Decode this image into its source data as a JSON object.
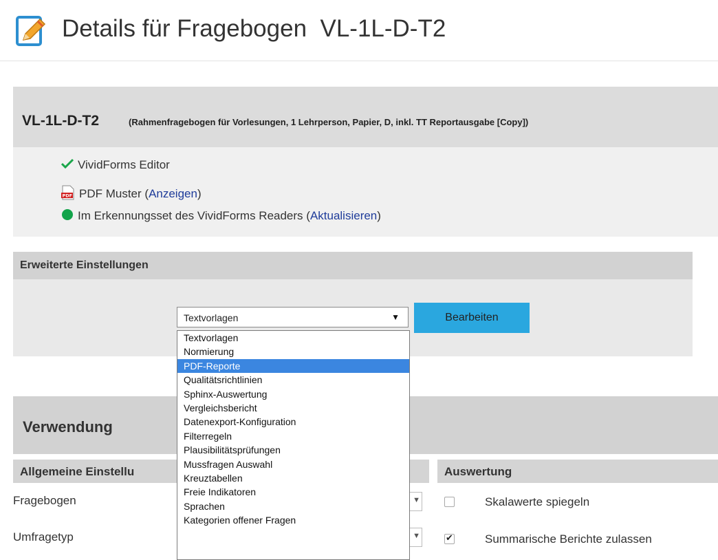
{
  "page": {
    "title": "Details für Fragebogen  VL-1L-D-T2"
  },
  "questionnaire": {
    "code": "VL-1L-D-T2",
    "description": "(Rahmenfragebogen für Vorlesungen, 1 Lehrperson, Papier, D, inkl. TT Reportausgabe [Copy])"
  },
  "status": {
    "editor": "VividForms Editor",
    "pdf_label": "PDF Muster (",
    "pdf_link": "Anzeigen",
    "pdf_close": ")",
    "reader_label": "Im Erkennungsset des VividForms Readers (",
    "reader_link": "Aktualisieren",
    "reader_close": ")"
  },
  "advanced": {
    "heading": "Erweiterte Einstellungen",
    "selected": "Textvorlagen",
    "edit_button": "Bearbeiten",
    "options": [
      "Textvorlagen",
      "Normierung",
      "PDF-Reporte",
      "Qualitätsrichtlinien",
      "Sphinx-Auswertung",
      "Vergleichsbericht",
      "Datenexport-Konfiguration",
      "Filterregeln",
      "Plausibilitätsprüfungen",
      "Mussfragen Auswahl",
      "Kreuztabellen",
      "Freie Indikatoren",
      "Sprachen",
      "Kategorien offener Fragen"
    ],
    "highlighted_option": "PDF-Reporte"
  },
  "usage": {
    "heading": "Verwendung",
    "general_heading": "Allgemeine Einstellungen",
    "general_visible": "Allgemeine Einstellu",
    "questionnaire_label": "Fragebogen",
    "survey_type_label": "Umfragetyp",
    "evaluation_heading": "Auswertung",
    "mirror_scale_label": "Skalawerte spiegeln",
    "mirror_scale_checked": false,
    "summary_reports_label": "Summarische Berichte zulassen",
    "summary_reports_checked": true
  },
  "colors": {
    "accent_button": "#2aa7df",
    "link": "#1f3c9a",
    "check_green": "#1aa64a",
    "status_dot": "#12a34a",
    "dropdown_highlight": "#3b86e0"
  }
}
